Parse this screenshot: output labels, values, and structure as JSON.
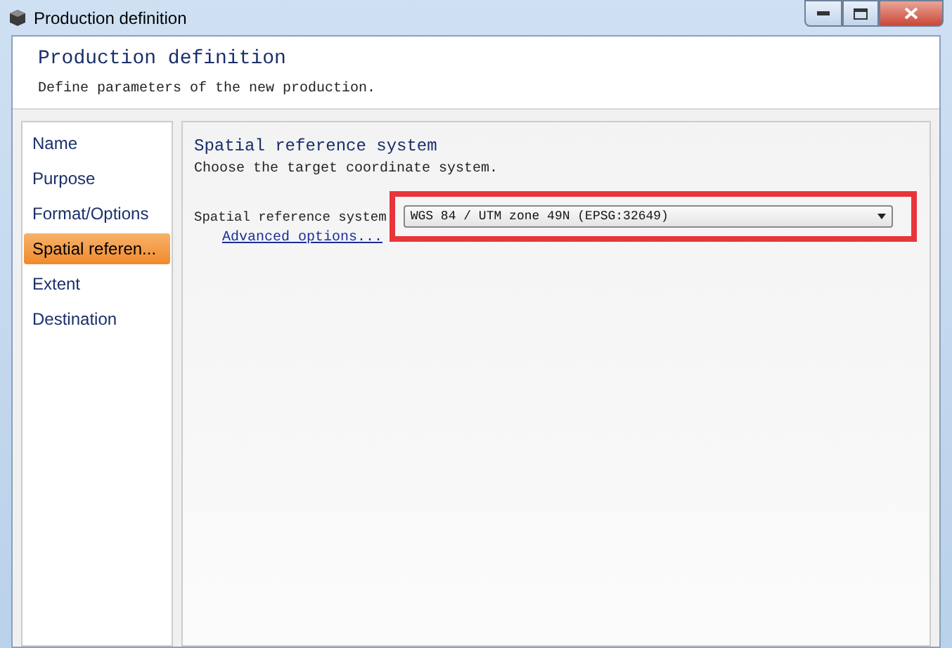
{
  "window": {
    "title": "Production definition"
  },
  "header": {
    "title": "Production definition",
    "subtitle": "Define parameters of the new production."
  },
  "sidebar": {
    "items": [
      {
        "label": "Name",
        "selected": false
      },
      {
        "label": "Purpose",
        "selected": false
      },
      {
        "label": "Format/Options",
        "selected": false
      },
      {
        "label": "Spatial referen...",
        "selected": true
      },
      {
        "label": "Extent",
        "selected": false
      },
      {
        "label": "Destination",
        "selected": false
      }
    ]
  },
  "content": {
    "title": "Spatial reference system",
    "subtitle": "Choose the target coordinate system.",
    "field_label": "Spatial reference system",
    "value": "WGS 84 / UTM zone 49N (EPSG:32649)",
    "highlighted": true,
    "link": "Advanced options..."
  }
}
